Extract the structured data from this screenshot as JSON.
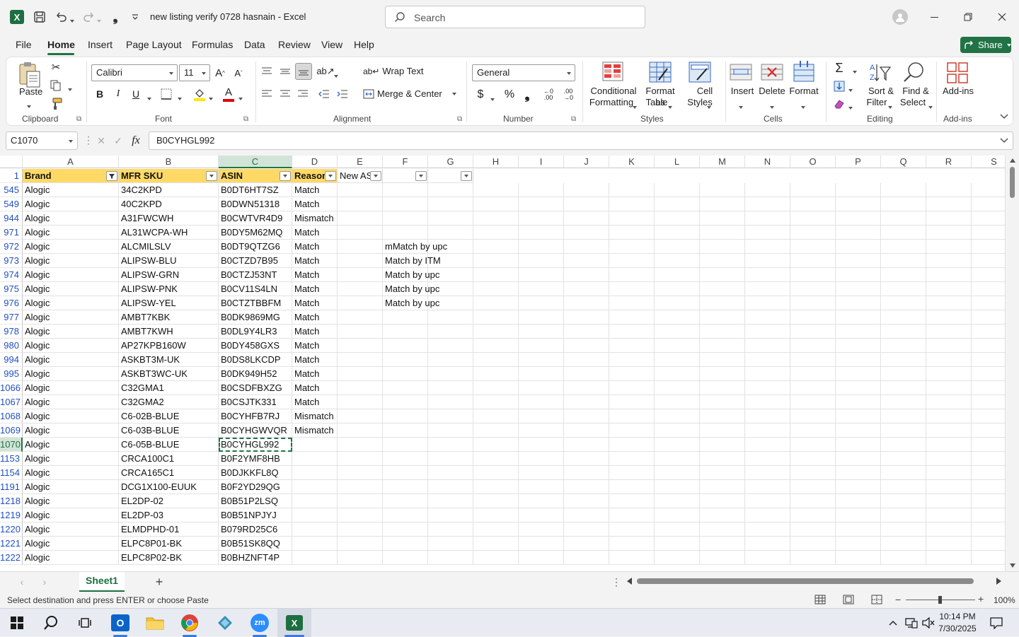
{
  "titlebar": {
    "doc_title": "new listing verify 0728 hasnain",
    "app_name": "Excel",
    "separator": "-",
    "search_placeholder": "Search",
    "autosave_icon": "excel-logo-icon"
  },
  "menu": {
    "tabs": [
      "File",
      "Home",
      "Insert",
      "Page Layout",
      "Formulas",
      "Data",
      "Review",
      "View",
      "Help"
    ],
    "active": "Home",
    "share_label": "Share"
  },
  "ribbon": {
    "clipboard": {
      "group": "Clipboard",
      "paste": "Paste"
    },
    "font": {
      "group": "Font",
      "font_name": "Calibri",
      "font_size": "11"
    },
    "alignment": {
      "group": "Alignment",
      "wrap_text": "Wrap Text",
      "merge_center": "Merge & Center"
    },
    "number": {
      "group": "Number",
      "format": "General"
    },
    "styles": {
      "group": "Styles",
      "cond_fmt_1": "Conditional",
      "cond_fmt_2": "Formatting",
      "fmt_table_1": "Format as",
      "fmt_table_2": "Table",
      "cell_styles_1": "Cell",
      "cell_styles_2": "Styles"
    },
    "cells": {
      "group": "Cells",
      "insert": "Insert",
      "delete": "Delete",
      "format": "Format"
    },
    "editing": {
      "group": "Editing",
      "sort_1": "Sort &",
      "sort_2": "Filter",
      "find_1": "Find &",
      "find_2": "Select"
    },
    "addins": {
      "group": "Add-ins",
      "label": "Add-ins"
    }
  },
  "formula_bar": {
    "name_box": "C1070",
    "fx": "fx",
    "value": "B0CYHGL992"
  },
  "columns": [
    "A",
    "B",
    "C",
    "D",
    "E",
    "F",
    "G",
    "H",
    "I",
    "J",
    "K",
    "L",
    "M",
    "N",
    "O",
    "P",
    "Q",
    "R",
    "S"
  ],
  "header_row": {
    "row_num": "1",
    "cells": [
      "Brand",
      "MFR SKU",
      "ASIN",
      "Reason",
      "New AS"
    ]
  },
  "rows": [
    {
      "n": "545",
      "a": "Alogic",
      "b": "34C2KPD",
      "c": "B0DT6HT7SZ",
      "d": "Match",
      "f": ""
    },
    {
      "n": "549",
      "a": "Alogic",
      "b": "40C2KPD",
      "c": "B0DWN51318",
      "d": "Match",
      "f": ""
    },
    {
      "n": "944",
      "a": "Alogic",
      "b": "A31FWCWH",
      "c": "B0CWTVR4D9",
      "d": "Mismatch",
      "f": ""
    },
    {
      "n": "971",
      "a": "Alogic",
      "b": "AL31WCPA-WH",
      "c": "B0DY5M62MQ",
      "d": "Match",
      "f": ""
    },
    {
      "n": "972",
      "a": "Alogic",
      "b": "ALCMILSLV",
      "c": "B0DT9QTZG6",
      "d": "Match",
      "f": "mMatch by upc"
    },
    {
      "n": "973",
      "a": "Alogic",
      "b": "ALIPSW-BLU",
      "c": "B0CTZD7B95",
      "d": "Match",
      "f": "Match by ITM"
    },
    {
      "n": "974",
      "a": "Alogic",
      "b": "ALIPSW-GRN",
      "c": "B0CTZJ53NT",
      "d": "Match",
      "f": "Match by upc"
    },
    {
      "n": "975",
      "a": "Alogic",
      "b": "ALIPSW-PNK",
      "c": "B0CV11S4LN",
      "d": "Match",
      "f": "Match by upc"
    },
    {
      "n": "976",
      "a": "Alogic",
      "b": "ALIPSW-YEL",
      "c": "B0CTZTBBFM",
      "d": "Match",
      "f": "Match by upc"
    },
    {
      "n": "977",
      "a": "Alogic",
      "b": "AMBT7KBK",
      "c": "B0DK9869MG",
      "d": "Match",
      "f": ""
    },
    {
      "n": "978",
      "a": "Alogic",
      "b": "AMBT7KWH",
      "c": "B0DL9Y4LR3",
      "d": "Match",
      "f": ""
    },
    {
      "n": "980",
      "a": "Alogic",
      "b": "AP27KPB160W",
      "c": "B0DY458GXS",
      "d": "Match",
      "f": ""
    },
    {
      "n": "994",
      "a": "Alogic",
      "b": "ASKBT3M-UK",
      "c": "B0DS8LKCDP",
      "d": "Match",
      "f": ""
    },
    {
      "n": "995",
      "a": "Alogic",
      "b": "ASKBT3WC-UK",
      "c": "B0DK949H52",
      "d": "Match",
      "f": ""
    },
    {
      "n": "1066",
      "a": "Alogic",
      "b": "C32GMA1",
      "c": "B0CSDFBXZG",
      "d": "Match",
      "f": ""
    },
    {
      "n": "1067",
      "a": "Alogic",
      "b": "C32GMA2",
      "c": "B0CSJTK331",
      "d": "Match",
      "f": ""
    },
    {
      "n": "1068",
      "a": "Alogic",
      "b": "C6-02B-BLUE",
      "c": "B0CYHFB7RJ",
      "d": "Mismatch",
      "f": ""
    },
    {
      "n": "1069",
      "a": "Alogic",
      "b": "C6-03B-BLUE",
      "c": "B0CYHGWVQR",
      "d": "Mismatch",
      "f": ""
    },
    {
      "n": "1070",
      "a": "Alogic",
      "b": "C6-05B-BLUE",
      "c": "B0CYHGL992",
      "d": "",
      "f": ""
    },
    {
      "n": "1153",
      "a": "Alogic",
      "b": "CRCA100C1",
      "c": "B0F2YMF8HB",
      "d": "",
      "f": ""
    },
    {
      "n": "1154",
      "a": "Alogic",
      "b": "CRCA165C1",
      "c": "B0DJKKFL8Q",
      "d": "",
      "f": ""
    },
    {
      "n": "1191",
      "a": "Alogic",
      "b": "DCG1X100-EUUK",
      "c": "B0F2YD29QG",
      "d": "",
      "f": ""
    },
    {
      "n": "1218",
      "a": "Alogic",
      "b": "EL2DP-02",
      "c": "B0B51P2LSQ",
      "d": "",
      "f": ""
    },
    {
      "n": "1219",
      "a": "Alogic",
      "b": "EL2DP-03",
      "c": "B0B51NPJYJ",
      "d": "",
      "f": ""
    },
    {
      "n": "1220",
      "a": "Alogic",
      "b": "ELMDPHD-01",
      "c": "B079RD25C6",
      "d": "",
      "f": ""
    },
    {
      "n": "1221",
      "a": "Alogic",
      "b": "ELPC8P01-BK",
      "c": "B0B51SK8QQ",
      "d": "",
      "f": ""
    },
    {
      "n": "1222",
      "a": "Alogic",
      "b": "ELPC8P02-BK",
      "c": "B0BHZNFT4P",
      "d": "",
      "f": ""
    }
  ],
  "sheet": {
    "tab": "Sheet1",
    "add": "+"
  },
  "status": {
    "message": "Select destination and press ENTER or choose Paste",
    "zoom": "100%"
  },
  "taskbar": {
    "time": "10:14 PM",
    "date": "7/30/2025"
  },
  "colors": {
    "excel_green": "#217346",
    "header_fill": "#ffd966",
    "selection": "#217346"
  }
}
